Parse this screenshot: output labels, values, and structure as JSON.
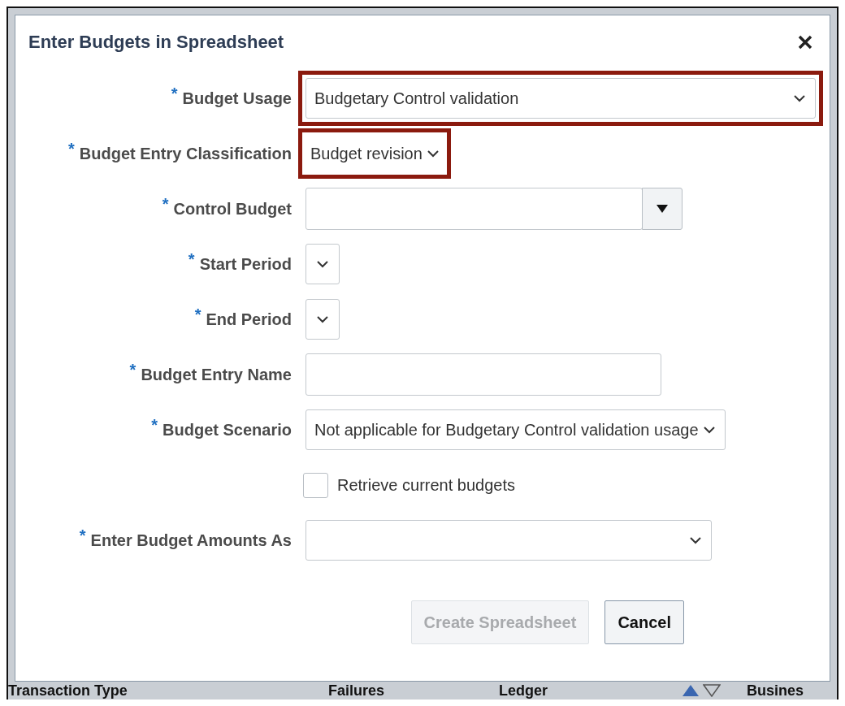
{
  "dialog": {
    "title": "Enter Budgets in Spreadsheet",
    "fields": [
      {
        "kind": "wide_select",
        "mark": "*",
        "label": "Budget Usage",
        "value": "Budgetary Control validation",
        "highlighted": true
      },
      {
        "kind": "inline_select",
        "mark": "*",
        "label": "Budget Entry Classification",
        "value": "Budget revision",
        "highlighted": true
      },
      {
        "kind": "combo",
        "mark": "*",
        "label": "Control Budget",
        "highlighted": false
      },
      {
        "kind": "small_select",
        "mark": "*",
        "label": "Start Period",
        "highlighted": false
      },
      {
        "kind": "small_select",
        "mark": "*",
        "label": "End Period",
        "highlighted": false
      },
      {
        "kind": "input",
        "mark": "*",
        "label": "Budget Entry Name",
        "highlighted": false
      },
      {
        "kind": "select",
        "mark": "*",
        "label": "Budget Scenario",
        "value": "Not applicable for Budgetary Control validation usage",
        "highlighted": false
      },
      {
        "kind": "checkbox",
        "label": "Retrieve current budgets",
        "checked": false
      },
      {
        "kind": "medium_select",
        "mark": "*",
        "label": "Enter Budget Amounts As",
        "highlighted": false
      }
    ],
    "buttons": [
      {
        "label": "Create Spreadsheet",
        "disabled": true
      },
      {
        "label": "Cancel",
        "disabled": false
      }
    ]
  },
  "background_table": {
    "columns": [
      "Transaction Type",
      "Failures",
      "Ledger",
      "Busines"
    ]
  }
}
